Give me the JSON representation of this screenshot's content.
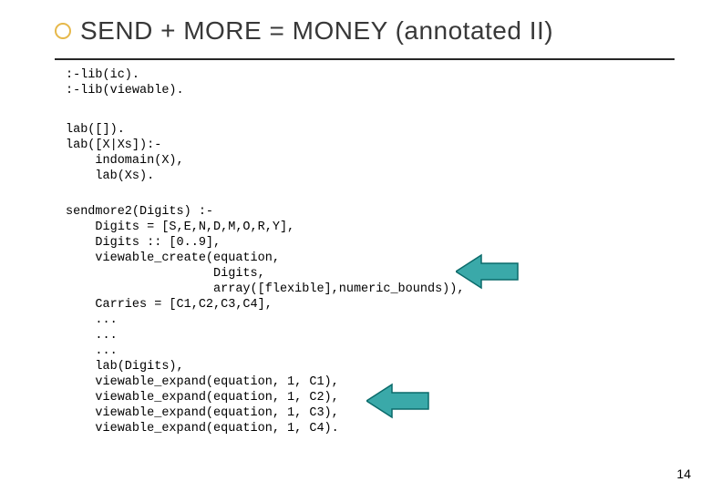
{
  "title": "SEND + MORE = MONEY (annotated II)",
  "code_block_1": ":-lib(ic).\n:-lib(viewable).",
  "code_block_2": "lab([]).\nlab([X|Xs]):-\n    indomain(X),\n    lab(Xs).",
  "code_block_3": "sendmore2(Digits) :-\n    Digits = [S,E,N,D,M,O,R,Y],\n    Digits :: [0..9],\n    viewable_create(equation,\n                    Digits,\n                    array([flexible],numeric_bounds)),\n    Carries = [C1,C2,C3,C4],\n    ...\n    ...\n    ...\n    lab(Digits),\n    viewable_expand(equation, 1, C1),\n    viewable_expand(equation, 1, C2),\n    viewable_expand(equation, 1, C3),\n    viewable_expand(equation, 1, C4).",
  "page_number": "14",
  "arrow_color": "#3aa9a9",
  "arrow_stroke": "#0b6b6b"
}
